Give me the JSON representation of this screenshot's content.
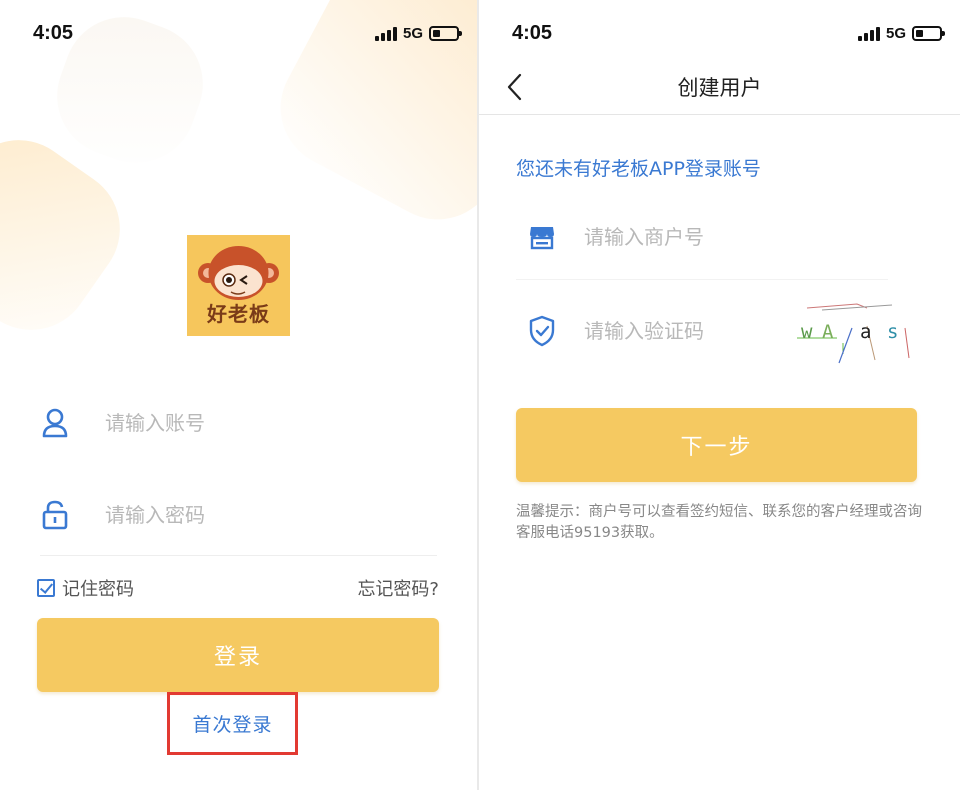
{
  "left": {
    "status": {
      "time": "4:05",
      "network": "5G",
      "battery_level": 0.3
    },
    "logo": {
      "text": "好老板"
    },
    "account_field": {
      "placeholder": "请输入账号",
      "icon": "user-icon"
    },
    "password_field": {
      "placeholder": "请输入密码",
      "icon": "lock-icon"
    },
    "remember": {
      "label": "记住密码",
      "checked": true
    },
    "forgot_label": "忘记密码?",
    "login_button": "登录",
    "first_login_link": "首次登录"
  },
  "right": {
    "status": {
      "time": "4:05",
      "network": "5G",
      "battery_level": 0.3
    },
    "nav": {
      "title": "创建用户",
      "back_icon": "chevron-left-icon"
    },
    "info": "您还未有好老板APP登录账号",
    "merchant_field": {
      "placeholder": "请输入商户号",
      "icon": "store-icon"
    },
    "code_field": {
      "placeholder": "请输入验证码",
      "icon": "shield-check-icon"
    },
    "captcha": {
      "chars": [
        "w",
        "A",
        "a",
        "s"
      ]
    },
    "next_button": "下一步",
    "tip": "温馨提示：商户号可以查看签约短信、联系您的客户经理或咨询客服电话95193获取。"
  },
  "colors": {
    "accent": "#3a79d2",
    "button": "#f5c961",
    "logo_bg": "#f6c65c",
    "highlight_border": "#e23a32"
  }
}
